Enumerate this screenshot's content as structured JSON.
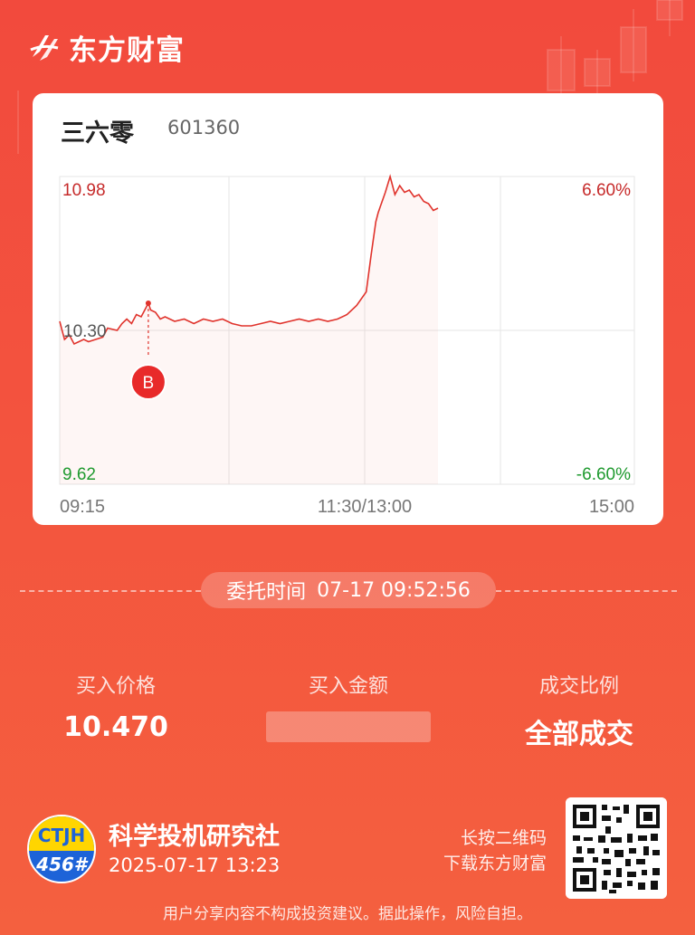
{
  "brand": {
    "name": "东方财富",
    "logo_icon": "eastmoney-logo-icon"
  },
  "stock": {
    "name": "三六零",
    "code": "601360"
  },
  "chart_data": {
    "type": "line",
    "title": "",
    "y_left_labels": {
      "top": "10.98",
      "mid": "10.30",
      "bottom": "9.62"
    },
    "y_right_labels": {
      "top": "6.60%",
      "bottom": "-6.60%"
    },
    "ylim": [
      9.62,
      10.98
    ],
    "prev_close": 10.3,
    "x_labels": [
      "09:15",
      "11:30/13:00",
      "15:00"
    ],
    "x_minutes": [
      0,
      135,
      240
    ],
    "series": [
      {
        "x": [
          0,
          1,
          2,
          4,
          6,
          8,
          10,
          12,
          15,
          18,
          20,
          24,
          26,
          28,
          30,
          32,
          34,
          36,
          37,
          38,
          40,
          42,
          44,
          48,
          52,
          56,
          60,
          64,
          68,
          72,
          76,
          80,
          84,
          88,
          92,
          96,
          100,
          104,
          108,
          112,
          116,
          120,
          124,
          128,
          130,
          132,
          133,
          134,
          136,
          138,
          140,
          141,
          142,
          144,
          146,
          148,
          150,
          152,
          154,
          156,
          158
        ],
        "values": [
          10.34,
          10.3,
          10.26,
          10.28,
          10.24,
          10.25,
          10.26,
          10.25,
          10.26,
          10.27,
          10.31,
          10.3,
          10.33,
          10.35,
          10.33,
          10.37,
          10.36,
          10.4,
          10.42,
          10.39,
          10.38,
          10.35,
          10.36,
          10.34,
          10.35,
          10.33,
          10.35,
          10.34,
          10.35,
          10.33,
          10.32,
          10.32,
          10.33,
          10.34,
          10.33,
          10.34,
          10.35,
          10.34,
          10.35,
          10.34,
          10.35,
          10.37,
          10.41,
          10.47,
          10.63,
          10.78,
          10.82,
          10.85,
          10.91,
          10.98,
          10.9,
          10.92,
          10.94,
          10.91,
          10.92,
          10.89,
          10.9,
          10.87,
          10.86,
          10.83,
          10.84
        ]
      }
    ],
    "buy_marker": {
      "x": 37,
      "price": 10.42,
      "label": "B"
    }
  },
  "order": {
    "time_label": "委托时间",
    "time_value": "07-17 09:52:56"
  },
  "stats": {
    "buy_price_label": "买入价格",
    "buy_price_value": "10.470",
    "buy_amount_label": "买入金额",
    "fill_ratio_label": "成交比例",
    "fill_ratio_value": "全部成交"
  },
  "user": {
    "avatar_top": "CTJH",
    "avatar_bottom": "456#",
    "name": "科学投机研究社",
    "time": "2025-07-17 13:23"
  },
  "qr": {
    "hint_line1": "长按二维码",
    "hint_line2": "下载东方财富"
  },
  "disclaimer": "用户分享内容不构成投资建议。据此操作，风险自担。"
}
